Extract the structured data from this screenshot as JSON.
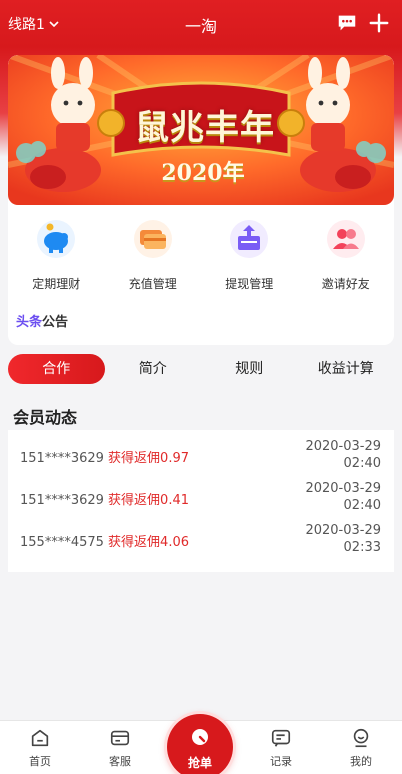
{
  "header": {
    "route_label": "线路1",
    "title": "一淘"
  },
  "banner": {
    "headline": "鼠兆丰年",
    "year": "2020年"
  },
  "quick_actions": [
    {
      "label": "定期理财",
      "icon": "piggy-bank-icon"
    },
    {
      "label": "充值管理",
      "icon": "card-icon"
    },
    {
      "label": "提现管理",
      "icon": "withdraw-icon"
    },
    {
      "label": "邀请好友",
      "icon": "users-icon"
    }
  ],
  "notice": {
    "part1": "头条",
    "part2": "公告"
  },
  "tabs": [
    "合作",
    "简介",
    "规则",
    "收益计算"
  ],
  "member_section_title": "会员动态",
  "member_activity": [
    {
      "user": "151****3629",
      "action": "获得返佣0.97",
      "date": "2020-03-29",
      "time": "02:40"
    },
    {
      "user": "151****3629",
      "action": "获得返佣0.41",
      "date": "2020-03-29",
      "time": "02:40"
    },
    {
      "user": "155****4575",
      "action": "获得返佣4.06",
      "date": "2020-03-29",
      "time": "02:33"
    }
  ],
  "bottom_nav": {
    "home": "首页",
    "service": "客服",
    "grab": "抢单",
    "records": "记录",
    "mine": "我的"
  },
  "colors": {
    "brand_red": "#d7191c",
    "notice_purple": "#6c4ff0",
    "highlight_red": "#e02a2a"
  }
}
